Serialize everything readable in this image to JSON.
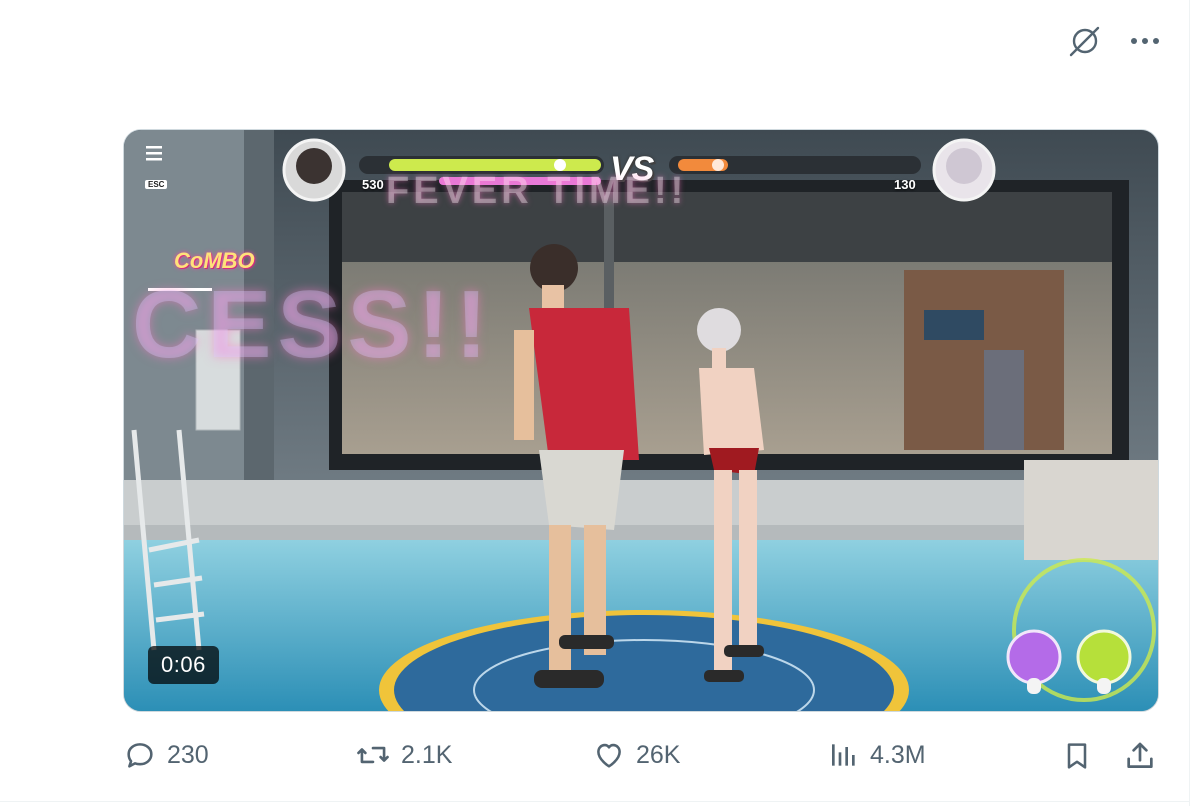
{
  "header": {
    "icons": {
      "grok": "grok-slash-icon",
      "more": "more-dots-icon"
    }
  },
  "video": {
    "timer": "0:06",
    "hud": {
      "menu_label": "ESC",
      "left_score": "530",
      "right_score": "130",
      "vs": "VS",
      "fever_text": "FEVER TIME!!",
      "combo_text": "CoMBO",
      "success_text": "CESS!!"
    }
  },
  "actions": {
    "replies": "230",
    "reposts": "2.1K",
    "likes": "26K",
    "views": "4.3M"
  },
  "colors": {
    "icon_gray": "#536471",
    "hud_green": "#cdea4d",
    "hud_pink": "#e77ad8",
    "hud_orange": "#f28a3c"
  }
}
